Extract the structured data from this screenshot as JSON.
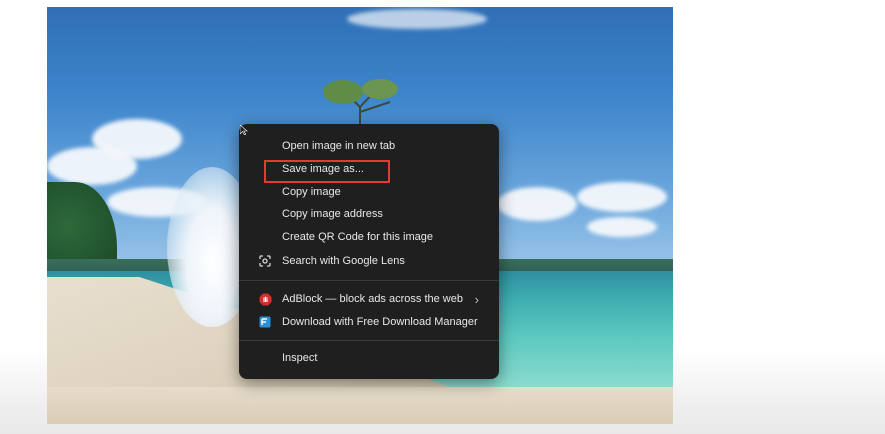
{
  "context_menu": {
    "items": [
      {
        "label": "Open image in new tab"
      },
      {
        "label": "Save image as..."
      },
      {
        "label": "Copy image"
      },
      {
        "label": "Copy image address"
      },
      {
        "label": "Create QR Code for this image"
      },
      {
        "label": "Search with Google Lens",
        "icon": "google-lens-icon"
      },
      {
        "label": "AdBlock — block ads across the web",
        "icon": "adblock-icon",
        "submenu": true
      },
      {
        "label": "Download with Free Download Manager",
        "icon": "fdm-icon"
      },
      {
        "label": "Inspect"
      }
    ],
    "highlighted_item": "Save image as...",
    "highlight_color": "#e53935"
  },
  "colors": {
    "menu_background": "#1f1f1f",
    "menu_text": "#e8e8e8"
  }
}
